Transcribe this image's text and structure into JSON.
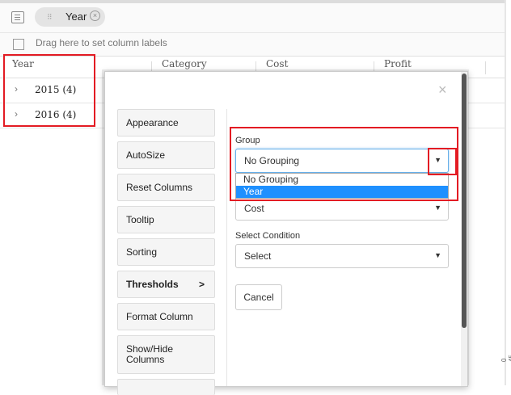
{
  "toolbar": {
    "chip_label": "Year",
    "chip_grip": "⠿",
    "chip_close": "×",
    "row_group_text": "Drag here to set column labels"
  },
  "grid": {
    "columns": [
      "Year",
      "Category",
      "Cost",
      "Profit"
    ],
    "rows": [
      {
        "label": "2015 (4)"
      },
      {
        "label": "2016 (4)"
      }
    ]
  },
  "modal": {
    "close": "×",
    "sidebar": [
      {
        "label": "Appearance"
      },
      {
        "label": "AutoSize"
      },
      {
        "label": "Reset Columns"
      },
      {
        "label": "Tooltip"
      },
      {
        "label": "Sorting"
      },
      {
        "label": "Thresholds",
        "arrow": ">"
      },
      {
        "label": "Format Column"
      },
      {
        "label": "Show/Hide Columns"
      }
    ],
    "form": {
      "group_label": "Group",
      "group_value": "No Grouping",
      "group_options": [
        "No Grouping",
        "Year"
      ],
      "group_selected_highlight": "Year",
      "cost_value": "Cost",
      "condition_label": "Select Condition",
      "condition_value": "Select",
      "caret": "▼",
      "cancel_label": "Cancel"
    }
  },
  "edge_text": "0 45-0",
  "colors": {
    "highlight": "#e31b23",
    "selected_option": "#1e90ff",
    "scrollbar": "#555555"
  }
}
